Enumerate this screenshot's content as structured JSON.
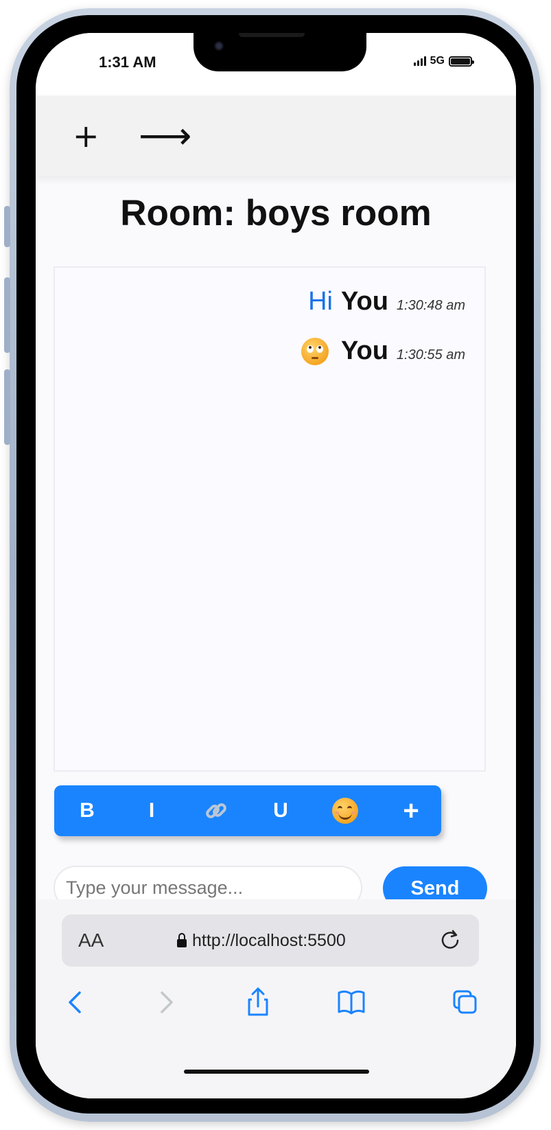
{
  "status_bar": {
    "time": "1:31 AM",
    "network": "5G"
  },
  "header": {
    "new_room_icon": "plus-icon",
    "enter_icon": "arrow-right-icon"
  },
  "room": {
    "title": "Room: boys room"
  },
  "messages": [
    {
      "text": "Hi",
      "user": "You",
      "time": "1:30:48 am"
    },
    {
      "emoji": "face-with-rolling-eyes",
      "user": "You",
      "time": "1:30:55 am"
    }
  ],
  "toolbar": {
    "bold_label": "B",
    "italic_label": "I",
    "underline_label": "U",
    "plus_label": "+",
    "link_icon": "link-icon",
    "emoji_icon": "smiling-face-icon"
  },
  "composer": {
    "placeholder": "Type your message...",
    "send_label": "Send"
  },
  "browser": {
    "text_size_label": "AA",
    "url": "http://localhost:5500"
  },
  "colors": {
    "accent": "#1a84ff",
    "message_text": "#1a73e8"
  }
}
